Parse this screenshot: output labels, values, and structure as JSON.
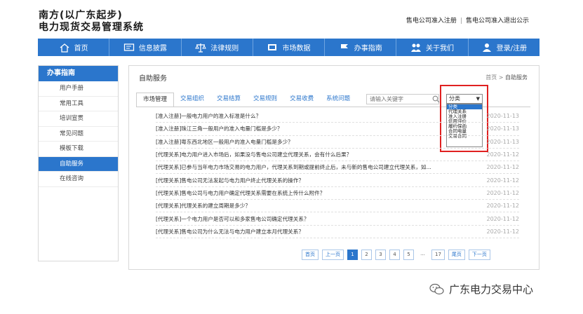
{
  "header": {
    "title_line1": "南方(以广东起步)",
    "title_line2": "电力现货交易管理系统",
    "links": [
      "售电公司准入注册",
      "售电公司准入退出公示"
    ]
  },
  "nav": [
    {
      "label": "首页",
      "icon": "home-icon"
    },
    {
      "label": "信息披露",
      "icon": "monitor-icon"
    },
    {
      "label": "法律规则",
      "icon": "scales-icon"
    },
    {
      "label": "市场数据",
      "icon": "screen-icon"
    },
    {
      "label": "办事指南",
      "icon": "flag-icon"
    },
    {
      "label": "关于我们",
      "icon": "people-icon"
    },
    {
      "label": "登录/注册",
      "icon": "user-icon"
    }
  ],
  "sidebar": {
    "title": "办事指南",
    "items": [
      "用户手册",
      "常用工具",
      "培训宣贯",
      "常见问题",
      "模板下载",
      "自助服务",
      "在线咨询"
    ],
    "active_index": 5
  },
  "main": {
    "title": "自助服务",
    "breadcrumb": [
      "首页",
      ">",
      "自助服务"
    ],
    "tabs": [
      "市场管理",
      "交易组织",
      "交易结算",
      "交易规则",
      "交易收费",
      "系统问题"
    ],
    "search_placeholder": "请输入关键字",
    "select_value": "分类",
    "select_options": [
      "分类",
      "代理关系",
      "准入注册",
      "信用评价",
      "履约保函",
      "合同电量",
      "交易合同"
    ]
  },
  "rows": [
    {
      "title": "[准入注册]一般电力用户的准入标准是什么？",
      "date": "2020-11-13"
    },
    {
      "title": "[准入注册]珠江三角一般用户的准入电量门槛是多少？",
      "date": "2020-11-13"
    },
    {
      "title": "[准入注册]粤东西北地区一般用户的准入电量门槛是多少？",
      "date": "2020-11-13"
    },
    {
      "title": "[代理关系]电力用户进入市场后，如果没与售电公司建立代理关系，会有什么后果？",
      "date": "2020-11-12"
    },
    {
      "title": "[代理关系]已参与当年电力市场交易的电力用户，代理关系到期或提前终止后，未与新的售电公司建立代理关系，如...",
      "date": "2020-11-12"
    },
    {
      "title": "[代理关系]售电公司无法发起与电力用户终止代理关系的操作？",
      "date": "2020-11-12"
    },
    {
      "title": "[代理关系]售电公司与电力用户确定代理关系需要在系统上传什么附件？",
      "date": "2020-11-12"
    },
    {
      "title": "[代理关系]代理关系的建立周期是多少？",
      "date": "2020-11-12"
    },
    {
      "title": "[代理关系]一个电力用户是否可以和多家售电公司确定代理关系？",
      "date": "2020-11-12"
    },
    {
      "title": "[代理关系]售电公司为什么无法与电力用户建立本月代理关系？",
      "date": "2020-11-12"
    }
  ],
  "pager": {
    "first": "首页",
    "prev": "上一页",
    "pages": [
      "1",
      "2",
      "3",
      "4",
      "5",
      "...",
      "17"
    ],
    "active": "1",
    "last": "尾页",
    "next": "下一页"
  },
  "watermark": "广东电力交易中心"
}
